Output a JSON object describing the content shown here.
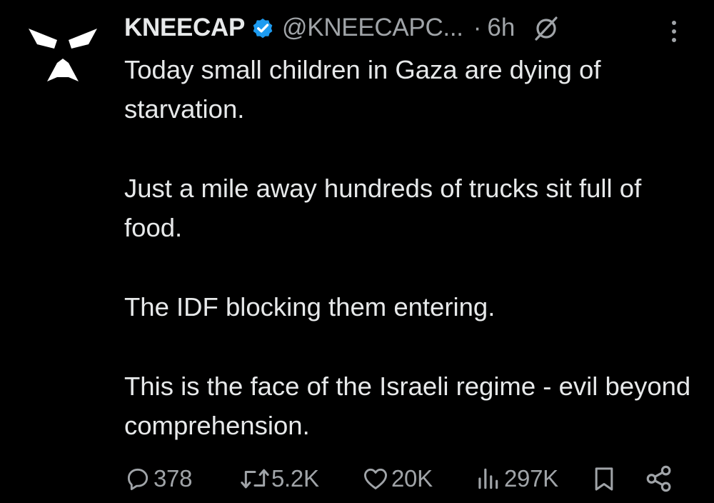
{
  "tweet": {
    "display_name": "KNEECAP",
    "handle": "@KNEECAPC...",
    "separator": "·",
    "time": "6h",
    "paragraphs": [
      "Today small children in Gaza are dying of starvation.",
      "Just a mile away hundreds of trucks sit full of food.",
      "The IDF blocking them entering.",
      "This is the face of the Israeli regime - evil beyond comprehension."
    ]
  },
  "actions": {
    "replies": "378",
    "reposts": "5.2K",
    "likes": "20K",
    "views": "297K"
  },
  "icons": {
    "avatar": "kneecap-logo-avatar",
    "verified": "verified-badge-icon",
    "grok": "grok-icon",
    "more": "more-options-icon",
    "reply": "reply-icon",
    "repost": "repost-icon",
    "like": "heart-icon",
    "views": "views-icon",
    "bookmark": "bookmark-icon",
    "share": "share-icon"
  },
  "colors": {
    "background": "#000000",
    "text": "#e7e9ea",
    "secondary": "#a0a4a8",
    "verified": "#1d9bf0"
  }
}
